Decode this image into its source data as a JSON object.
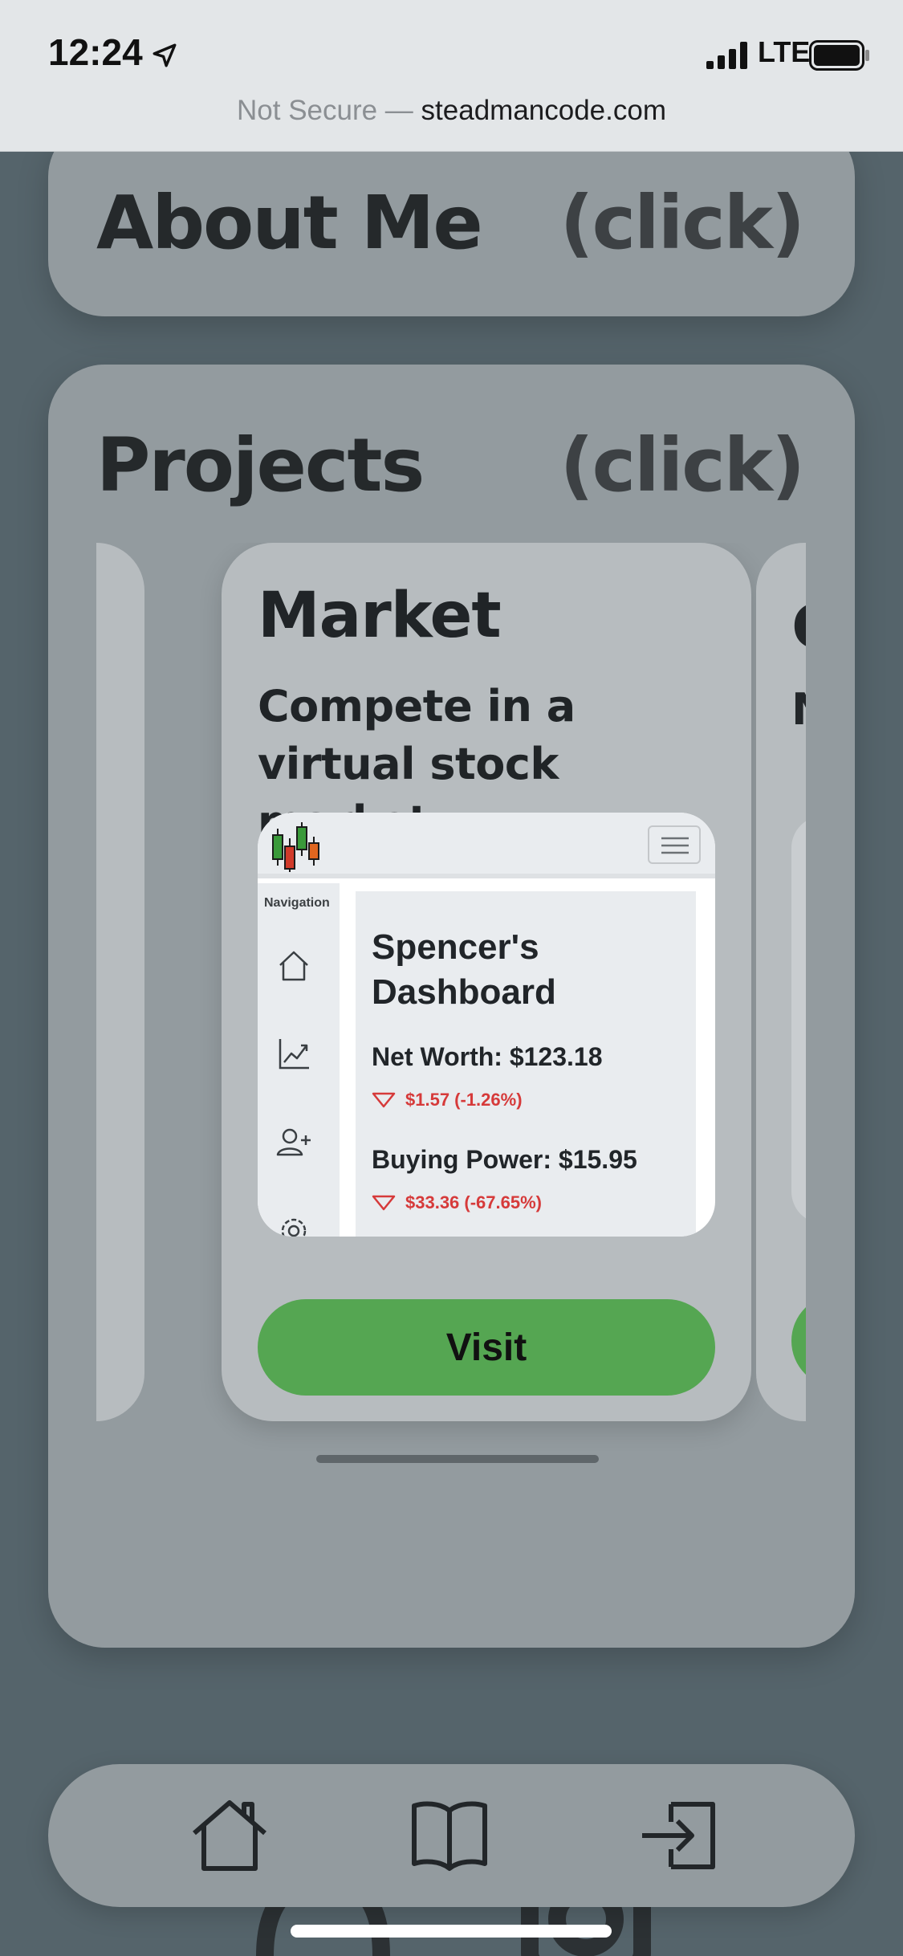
{
  "status_bar": {
    "time": "12:24",
    "network": "LTE"
  },
  "url_bar": {
    "security": "Not Secure — ",
    "domain": "steadmancode.com"
  },
  "about": {
    "title": "About Me",
    "click_label": "(click)"
  },
  "projects": {
    "title": "Projects",
    "click_label": "(click)",
    "items": [
      {
        "name": "Market",
        "description": "Compete in a virtual stock market",
        "visit_label": "Visit",
        "preview": {
          "nav_label": "Navigation",
          "nav_icons": [
            "home-icon",
            "chart-line-icon",
            "person-add-icon",
            "gear-icon"
          ],
          "dashboard_title": "Spencer's Dashboard",
          "stats": [
            {
              "label": "Net Worth: $123.18",
              "change": "$1.57 (-1.26%)"
            },
            {
              "label": "Buying Power: $15.95",
              "change": "$33.36 (-67.65%)"
            }
          ]
        }
      },
      {
        "name": "C",
        "description": "N c"
      }
    ]
  },
  "bottom_nav": {
    "icons": [
      "home-icon",
      "book-icon",
      "sign-in-icon"
    ]
  },
  "colors": {
    "background": "#55646b",
    "card": "#939b9f",
    "project_card": "#b7bcbf",
    "visit_button": "#55a652",
    "negative_change": "#d63a3a"
  }
}
